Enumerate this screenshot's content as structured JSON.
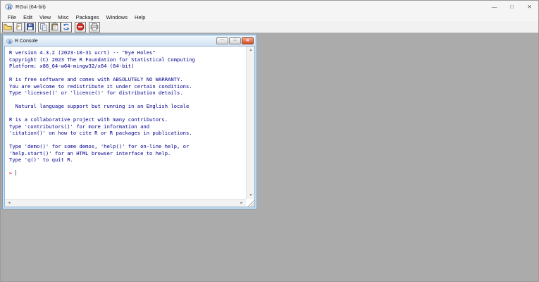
{
  "window": {
    "title": "RGui (64-bit)"
  },
  "menu": {
    "items": [
      "File",
      "Edit",
      "View",
      "Misc",
      "Packages",
      "Windows",
      "Help"
    ]
  },
  "toolbar": {
    "buttons": [
      "open-script",
      "load-workspace",
      "save-workspace",
      "copy",
      "paste",
      "copy-and-paste",
      "stop-computation",
      "print"
    ]
  },
  "console": {
    "title": "R Console",
    "prompt": "> ",
    "lines": [
      "R version 4.3.2 (2023-10-31 ucrt) -- \"Eye Holes\"",
      "Copyright (C) 2023 The R Foundation for Statistical Computing",
      "Platform: x86_64-w64-mingw32/x64 (64-bit)",
      "",
      "R is free software and comes with ABSOLUTELY NO WARRANTY.",
      "You are welcome to redistribute it under certain conditions.",
      "Type 'license()' or 'licence()' for distribution details.",
      "",
      "  Natural language support but running in an English locale",
      "",
      "R is a collaborative project with many contributors.",
      "Type 'contributors()' for more information and",
      "'citation()' on how to cite R or R packages in publications.",
      "",
      "Type 'demo()' for some demos, 'help()' for on-line help, or",
      "'help.start()' for an HTML browser interface to help.",
      "Type 'q()' to quit R.",
      ""
    ]
  },
  "icons": {
    "minimize": "—",
    "maximize": "□",
    "close": "✕",
    "console_minimize": "—",
    "console_maximize": "□",
    "console_close": "✕",
    "scroll_up": "▲",
    "scroll_down": "▼",
    "scroll_left": "◄",
    "scroll_right": "►"
  },
  "colors": {
    "output_text": "#00008B",
    "prompt_text": "#cc0000",
    "mdi_background": "#ababab",
    "console_frame": "#bdd8ee",
    "close_button": "#cf4e28"
  }
}
